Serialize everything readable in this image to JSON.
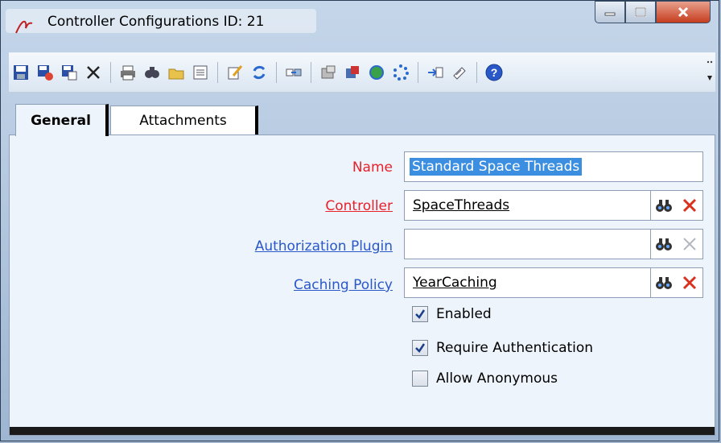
{
  "window": {
    "title": "Controller Configurations ID: 21"
  },
  "toolbar": {
    "icons": [
      "save-icon",
      "save-close-icon",
      "save-copy-icon",
      "delete-icon",
      "print-icon",
      "find-icon",
      "open-folder-icon",
      "list-icon",
      "edit-icon",
      "refresh-icon",
      "move-icon",
      "tools-icon",
      "export-icon",
      "globe-icon",
      "loading-icon",
      "import-icon",
      "attach-icon",
      "help-icon"
    ]
  },
  "tabs": {
    "general": "General",
    "attachments": "Attachments"
  },
  "form": {
    "name_label": "Name",
    "name_value": "Standard Space Threads",
    "controller_label": "Controller",
    "controller_value": "SpaceThreads",
    "auth_label": "Authorization Plugin",
    "auth_value": "",
    "caching_label": "Caching Policy",
    "caching_value": "YearCaching",
    "enabled_label": "Enabled",
    "enabled_checked": true,
    "require_auth_label": "Require Authentication",
    "require_auth_checked": true,
    "allow_anon_label": "Allow Anonymous",
    "allow_anon_checked": false
  },
  "colors": {
    "required_label": "#e8202a",
    "link_label": "#2a58c8",
    "selection": "#3c8fe0"
  }
}
